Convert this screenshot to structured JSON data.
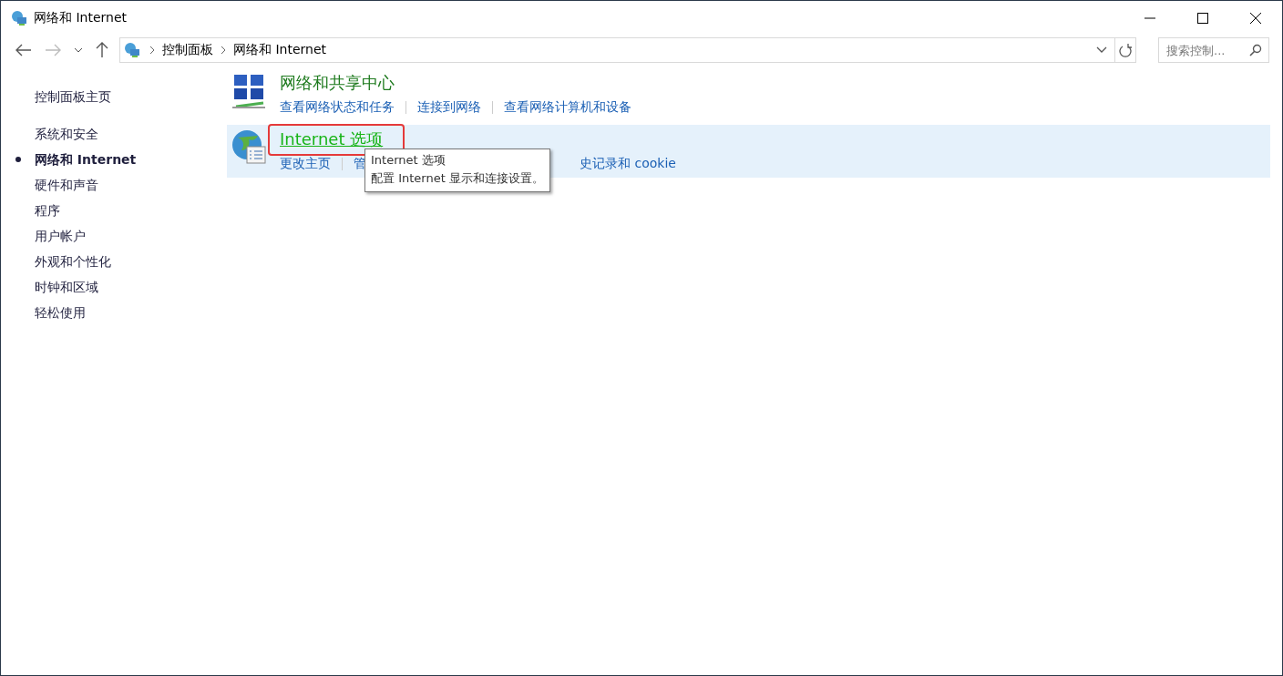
{
  "window": {
    "title": "网络和 Internet"
  },
  "address_bar": {
    "crumbs": [
      "控制面板",
      "网络和 Internet"
    ]
  },
  "search": {
    "placeholder": "搜索控制..."
  },
  "sidebar": {
    "home": "控制面板主页",
    "items": [
      {
        "label": "系统和安全",
        "selected": false
      },
      {
        "label": "网络和 Internet",
        "selected": true
      },
      {
        "label": "硬件和声音",
        "selected": false
      },
      {
        "label": "程序",
        "selected": false
      },
      {
        "label": "用户帐户",
        "selected": false
      },
      {
        "label": "外观和个性化",
        "selected": false
      },
      {
        "label": "时钟和区域",
        "selected": false
      },
      {
        "label": "轻松使用",
        "selected": false
      }
    ]
  },
  "categories": [
    {
      "kind": "network",
      "title": "网络和共享中心",
      "hovered": false,
      "highlighted": false,
      "links": [
        "查看网络状态和任务",
        "连接到网络",
        "查看网络计算机和设备"
      ]
    },
    {
      "kind": "globe",
      "title": "Internet 选项",
      "hovered": true,
      "highlighted": true,
      "links": [
        "更改主页",
        "管",
        "史记录和 cookie"
      ]
    }
  ],
  "tooltip": {
    "title": "Internet 选项",
    "text": "配置 Internet 显示和连接设置。"
  }
}
